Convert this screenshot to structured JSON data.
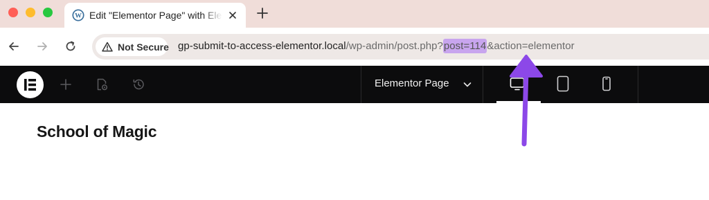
{
  "browser": {
    "tab": {
      "title": "Edit \"Elementor Page\" with Elementor",
      "favicon": "wordpress-icon"
    },
    "new_tab_icon": "plus-icon",
    "nav": {
      "back": "arrow-left-icon",
      "forward": "arrow-right-icon",
      "reload": "reload-icon"
    },
    "address_bar": {
      "security_label": "Not Secure",
      "security_icon": "warning-triangle-icon",
      "url_host": "gp-submit-to-access-elementor.local",
      "url_path": "/wp-admin/post.php?",
      "url_highlight": "post=114",
      "url_rest": "&action=elementor"
    },
    "colors": {
      "tabstrip_bg": "#f0ddd9",
      "highlight": "#c8a5ee",
      "arrow": "#8c48e8"
    }
  },
  "editor": {
    "logo": "elementor-logo",
    "toolbar_icons": [
      "plus-icon",
      "page-settings-icon",
      "history-icon"
    ],
    "page_selector": {
      "label": "Elementor Page",
      "icon": "chevron-down-icon"
    },
    "devices": [
      "desktop-icon",
      "tablet-icon",
      "mobile-icon"
    ],
    "active_device": "desktop",
    "bar_bg": "#0c0c0d"
  },
  "canvas": {
    "heading": "School of Magic"
  }
}
